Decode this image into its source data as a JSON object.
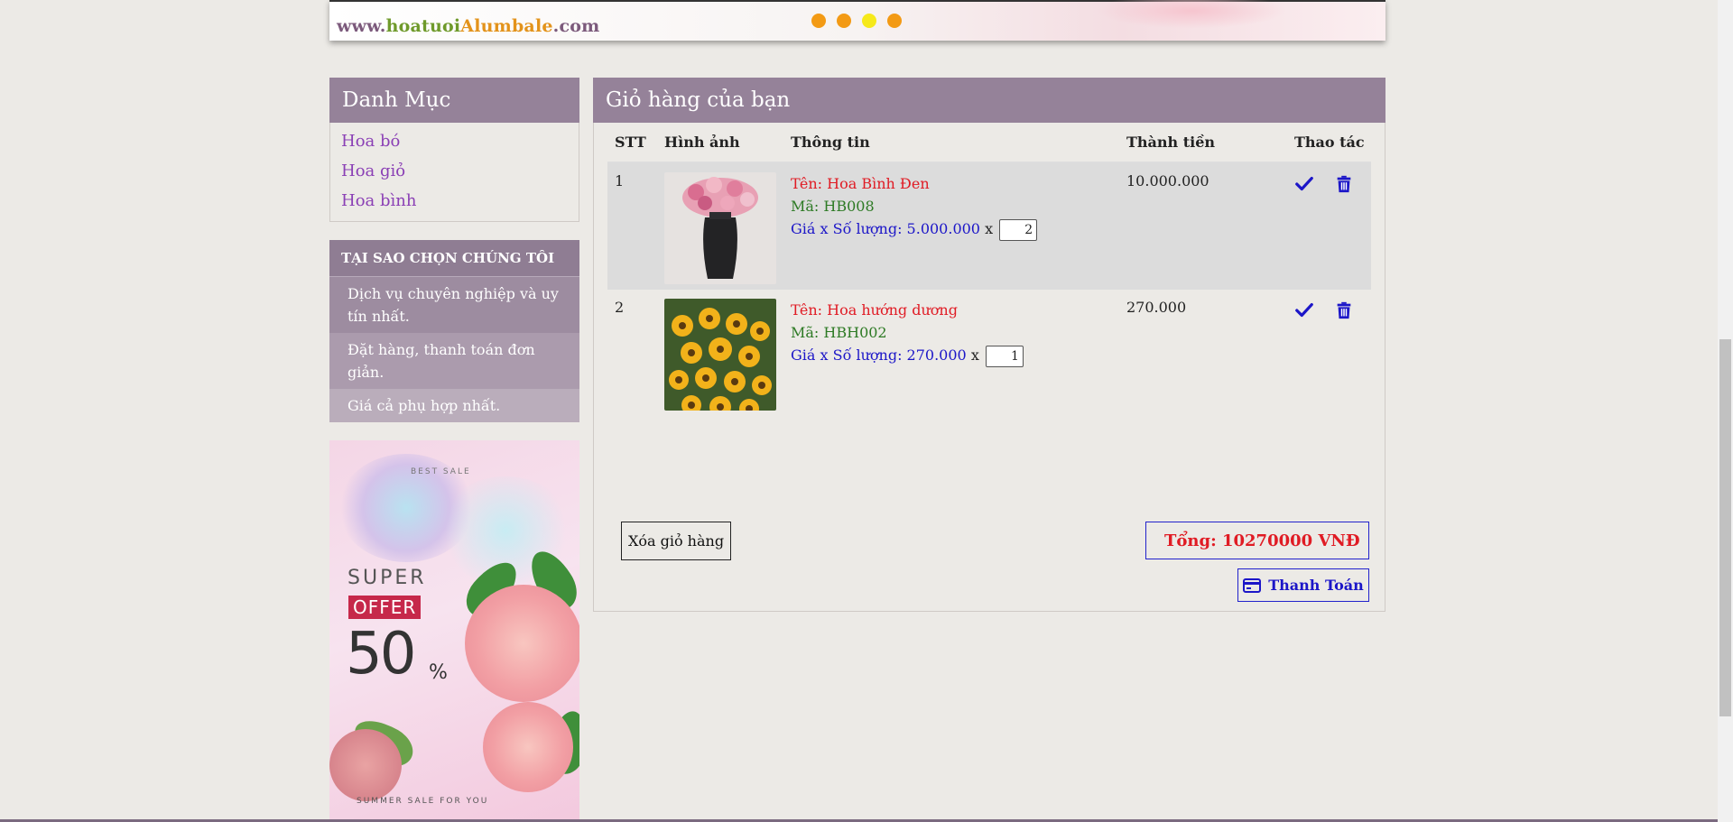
{
  "banner": {
    "logo_part1": "www.",
    "logo_part2": "hoatuoi",
    "logo_part3": "Alumbale",
    "logo_part4": ".com",
    "slide_count": 4,
    "active_slide": 3
  },
  "sidebar": {
    "categories_title": "Danh Mục",
    "categories": [
      {
        "label": "Hoa bó"
      },
      {
        "label": "Hoa giỏ"
      },
      {
        "label": "Hoa bình"
      }
    ],
    "why_title": "TẠI SAO CHỌN CHÚNG TÔI",
    "why_items": [
      "Dịch vụ chuyên nghiệp và uy tín nhất.",
      "Đặt hàng, thanh toán đơn giản.",
      "Giá cả phụ hợp nhất."
    ],
    "promo": {
      "best_sale": "BEST SALE",
      "super": "SUPER",
      "offer": "OFFER",
      "percent_value": "50",
      "percent_sign": "%",
      "footer": "SUMMER SALE FOR YOU"
    }
  },
  "cart": {
    "title": "Giỏ hàng của bạn",
    "columns": {
      "stt": "STT",
      "image": "Hình ảnh",
      "info": "Thông tin",
      "subtotal": "Thành tiền",
      "actions": "Thao tác"
    },
    "rows": [
      {
        "stt": "1",
        "name": "Tên: Hoa Bình Đen",
        "code": "Mã: HB008",
        "price_qty": "Giá x Số lượng: 5.000.000",
        "times": "x",
        "qty": "2",
        "subtotal": "10.000.000"
      },
      {
        "stt": "2",
        "name": "Tên: Hoa hướng dương",
        "code": "Mã: HBH002",
        "price_qty": "Giá x Số lượng: 270.000",
        "times": "x",
        "qty": "1",
        "subtotal": "270.000"
      }
    ],
    "clear_label": "Xóa giỏ hàng",
    "total_label": "Tổng: 10270000 VNĐ",
    "pay_label": "Thanh Toán"
  },
  "colors": {
    "panel_header": "#958299",
    "accent_blue": "#1c16c8",
    "accent_red": "#e01b24",
    "code_green": "#2d7a24",
    "link_purple": "#8a3fb5"
  },
  "icons": {
    "update": "check-icon",
    "delete": "trash-icon",
    "pay": "credit-card-icon"
  }
}
